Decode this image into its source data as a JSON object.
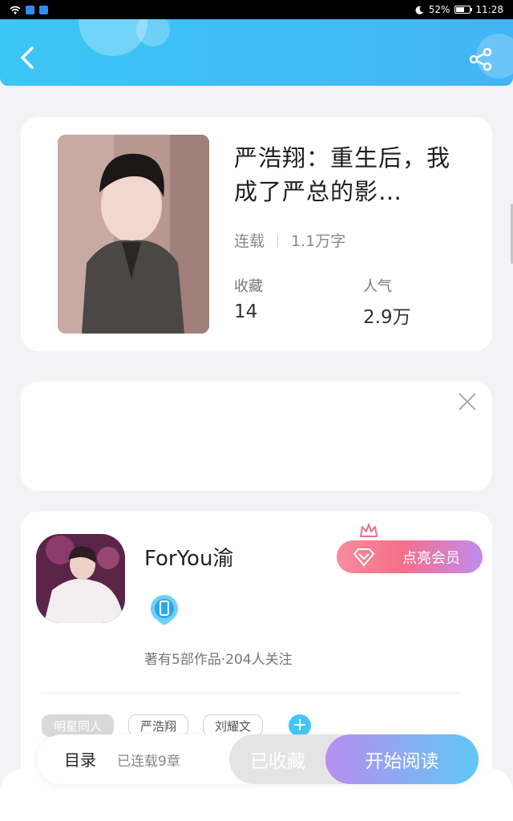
{
  "status_bar": {
    "battery": "52%",
    "time": "11:28"
  },
  "book": {
    "title": "严浩翔：重生后，我成了严总的影…",
    "status": "连载",
    "word_count": "1.1万字",
    "favorites_label": "收藏",
    "favorites_value": "14",
    "popularity_label": "人气",
    "popularity_value": "2.9万"
  },
  "author": {
    "name": "ForYou渝",
    "vip_label": "点亮会员",
    "stats": "著有5部作品·204人关注"
  },
  "tags": [
    "明星同人",
    "严浩翔",
    "刘耀文"
  ],
  "bottom": {
    "toc_label": "目录",
    "chapters_label": "已连载9章",
    "favorite_label": "已收藏",
    "read_label": "开始阅读"
  },
  "icons": [
    "back-arrow-icon",
    "share-icon",
    "close-icon",
    "crown-icon",
    "diamond-icon",
    "badge-icon",
    "plus-icon"
  ]
}
